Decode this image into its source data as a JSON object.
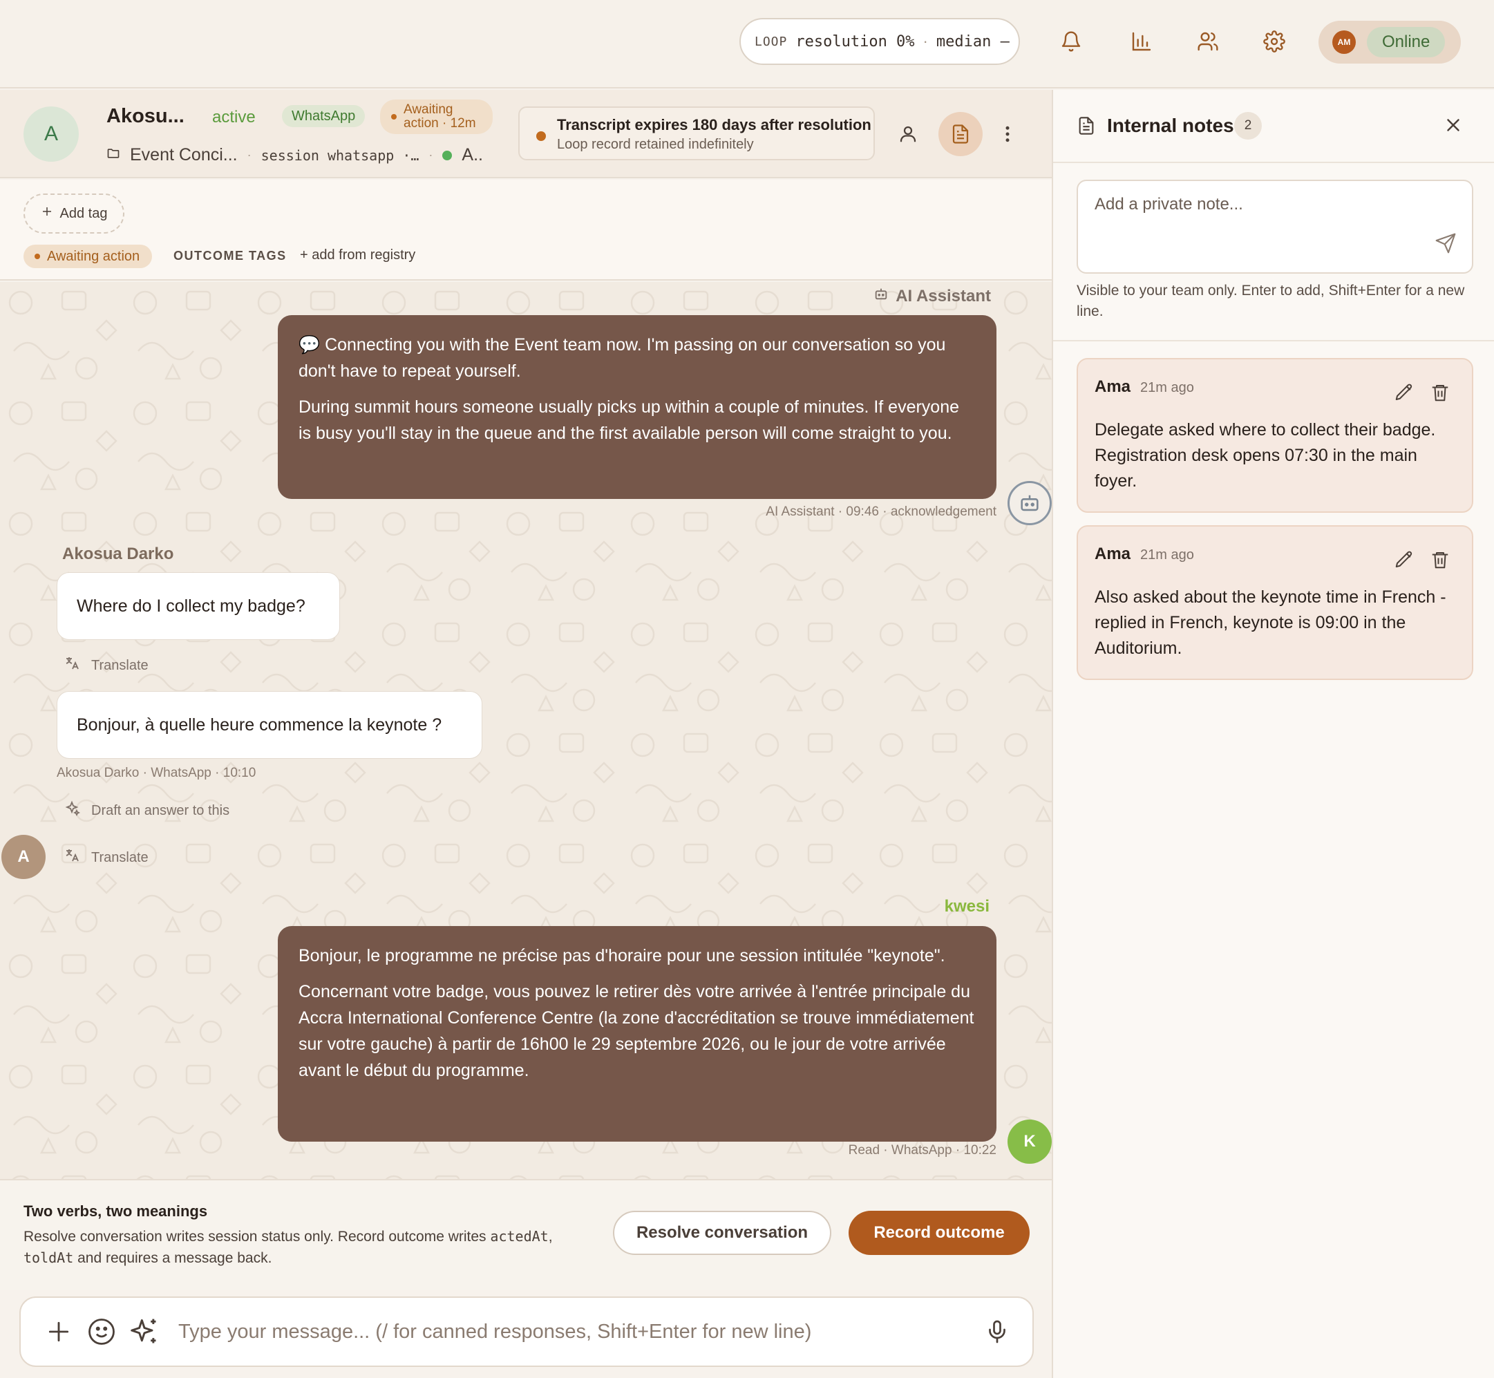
{
  "topbar": {
    "loop_label": "LOOP",
    "loop_stats": "resolution 0%",
    "loop_sep": "·",
    "loop_median": "median —",
    "user_initials": "AM",
    "status": "Online"
  },
  "conversation": {
    "avatar_letter": "A",
    "name": "Akosu...",
    "status": "active",
    "channel": "WhatsApp",
    "awaiting_line1": "Awaiting",
    "awaiting_line2": "action · 12m",
    "folder": "Event Conci...",
    "session": "session whatsapp ·…",
    "agent_short": "A..",
    "transcript_title": "Transcript expires 180 days after resolution",
    "transcript_sub": "Loop record retained indefinitely"
  },
  "tags": {
    "add_tag": "Add tag",
    "awaiting": "Awaiting action",
    "outcome_label": "OUTCOME TAGS",
    "add_registry": "+ add from registry"
  },
  "messages": {
    "ai_sender": "AI Assistant",
    "ai_p1": "💬 Connecting you with the Event team now. I'm passing on our conversation so you don't have to repeat yourself.",
    "ai_p2": "During summit hours someone usually picks up within a couple of minutes. If everyone is busy you'll stay in the queue and the first available person will come straight to you.",
    "ai_meta": "AI Assistant · 09:46 · acknowledgement",
    "customer_name": "Akosua Darko",
    "customer_avatar": "A",
    "msg1": "Where do I collect my badge?",
    "translate": "Translate",
    "msg2": "Bonjour, à quelle heure commence la keynote ?",
    "msg2_meta": "Akosua Darko · WhatsApp · 10:10",
    "draft_answer": "Draft an answer to this",
    "agent_name": "kwesi",
    "agent_avatar": "K",
    "reply_p1": "Bonjour, le programme ne précise pas d'horaire pour une session intitulée \"keynote\".",
    "reply_p2": "Concernant votre badge, vous pouvez le retirer dès votre arrivée à l'entrée principale du Accra International Conference Centre (la zone d'accréditation se trouve immédiatement sur votre gauche) à partir de 16h00 le 29 septembre 2026, ou le jour de votre arrivée avant le début du programme.",
    "reply_meta": "Read · WhatsApp · 10:22"
  },
  "actions": {
    "title": "Two verbs, two meanings",
    "desc_1": "Resolve conversation writes session status only. Record outcome writes",
    "desc_code1": "actedAt",
    "desc_comma": ",",
    "desc_code2": "toldAt",
    "desc_2": "and requires a message back.",
    "resolve_btn": "Resolve conversation",
    "record_btn": "Record outcome"
  },
  "composer": {
    "placeholder": "Type your message... (/ for canned responses, Shift+Enter for new line)"
  },
  "notes": {
    "title": "Internal notes",
    "count": "2",
    "input_placeholder": "Add a private note...",
    "hint": "Visible to your team only. Enter to add, Shift+Enter for a new line.",
    "items": [
      {
        "author": "Ama",
        "time": "21m ago",
        "body": "Delegate asked where to collect their badge. Registration desk opens 07:30 in the main foyer."
      },
      {
        "author": "Ama",
        "time": "21m ago",
        "body": "Also asked about the keynote time in French - replied in French, keynote is 09:00 in the Auditorium."
      }
    ]
  },
  "colors": {
    "accent": "#b05a1e",
    "bubble_out": "#76574a",
    "online": "#3f6b36",
    "agent": "#87bd48"
  }
}
